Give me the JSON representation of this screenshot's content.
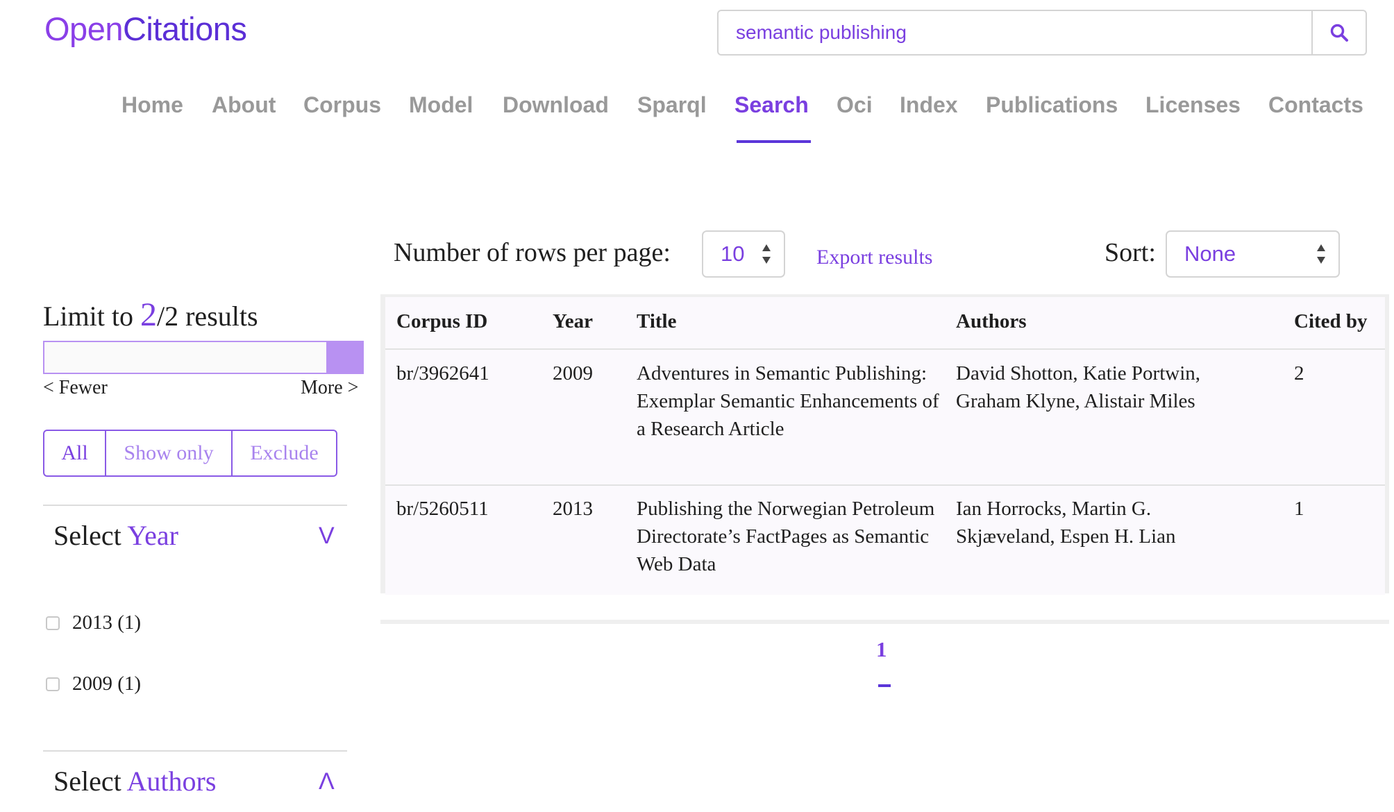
{
  "logo": {
    "part1": "Open",
    "part2": "Citations"
  },
  "search": {
    "value": "semantic publishing",
    "icon": "search-icon"
  },
  "nav": {
    "items": [
      {
        "label": "Home"
      },
      {
        "label": "About"
      },
      {
        "label": "Corpus"
      },
      {
        "label": "Model"
      },
      {
        "label": "Download"
      },
      {
        "label": "Sparql"
      },
      {
        "label": "Search"
      },
      {
        "label": "Oci"
      },
      {
        "label": "Index"
      },
      {
        "label": "Publications"
      },
      {
        "label": "Licenses"
      },
      {
        "label": "Contacts"
      }
    ],
    "active": "Search"
  },
  "controls": {
    "rows_label": "Number of rows per page:",
    "rows_value": "10",
    "export_label": "Export results",
    "sort_label": "Sort:",
    "sort_value": "None"
  },
  "sidebar": {
    "limit_prefix": "Limit to",
    "limit_current": "2",
    "limit_suffix": "/2 results",
    "slider_fraction": 1.0,
    "fewer_label": "< Fewer",
    "more_label": "More >",
    "filters": [
      {
        "label": "All"
      },
      {
        "label": "Show only"
      },
      {
        "label": "Exclude"
      }
    ],
    "active_filter": "All",
    "year_section": {
      "prefix": "Select",
      "accent": "Year",
      "chevron": "V",
      "options": [
        {
          "label": "2013 (1)"
        },
        {
          "label": "2009 (1)"
        }
      ]
    },
    "authors_section": {
      "prefix": "Select",
      "accent": "Authors",
      "chevron": "Λ"
    }
  },
  "table": {
    "columns": [
      "Corpus ID",
      "Year",
      "Title",
      "Authors",
      "Cited by"
    ],
    "rows": [
      {
        "id": "br/3962641",
        "year": "2009",
        "title": "Adventures in Semantic Publishing: Exemplar Semantic Enhancements of a Research Article",
        "authors": "David Shotton, Katie Portwin, Graham Klyne, Alistair Miles",
        "cited": "2"
      },
      {
        "id": "br/5260511",
        "year": "2013",
        "title": "Publishing the Norwegian Petroleum Directorate’s FactPages as Semantic Web Data",
        "authors": "Ian Horrocks, Martin G. Skjæveland, Espen H. Lian",
        "cited": "1"
      }
    ]
  },
  "pagination": {
    "current": "1"
  },
  "colors": {
    "accent": "#7a3fe0",
    "accent_dark": "#5b36d9",
    "muted": "#999999"
  }
}
